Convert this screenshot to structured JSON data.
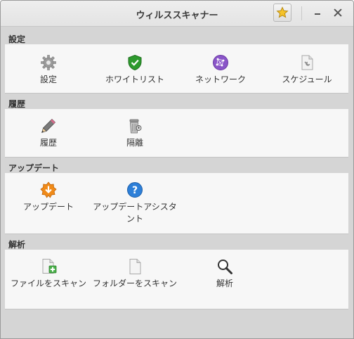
{
  "window": {
    "title": "ウィルススキャナー"
  },
  "titlebar": {
    "favorite_icon": "star-icon",
    "minimize_icon": "minimize-icon",
    "close_icon": "close-icon"
  },
  "sections": [
    {
      "header": "設定",
      "items": [
        {
          "label": "設定",
          "icon": "gear-icon"
        },
        {
          "label": "ホワイトリスト",
          "icon": "shield-check-icon"
        },
        {
          "label": "ネットワーク",
          "icon": "network-icon"
        },
        {
          "label": "スケジュール",
          "icon": "schedule-icon"
        }
      ]
    },
    {
      "header": "履歴",
      "items": [
        {
          "label": "履歴",
          "icon": "pencil-icon"
        },
        {
          "label": "隔離",
          "icon": "trash-icon"
        }
      ]
    },
    {
      "header": "アップデート",
      "items": [
        {
          "label": "アップデート",
          "icon": "update-icon"
        },
        {
          "label": "アップデートアシスタント",
          "icon": "help-icon"
        }
      ]
    },
    {
      "header": "解析",
      "items": [
        {
          "label": "ファイルをスキャン",
          "icon": "file-add-icon"
        },
        {
          "label": "フォルダーをスキャン",
          "icon": "document-icon"
        },
        {
          "label": "解析",
          "icon": "magnifier-icon"
        }
      ]
    }
  ],
  "colors": {
    "window_bg": "#d5d5d5",
    "panel_bg": "#f7f7f7",
    "shield_green": "#2e9a2e",
    "network_purple": "#8a55c8",
    "update_orange": "#f08a18",
    "help_blue": "#2d7fd8"
  }
}
